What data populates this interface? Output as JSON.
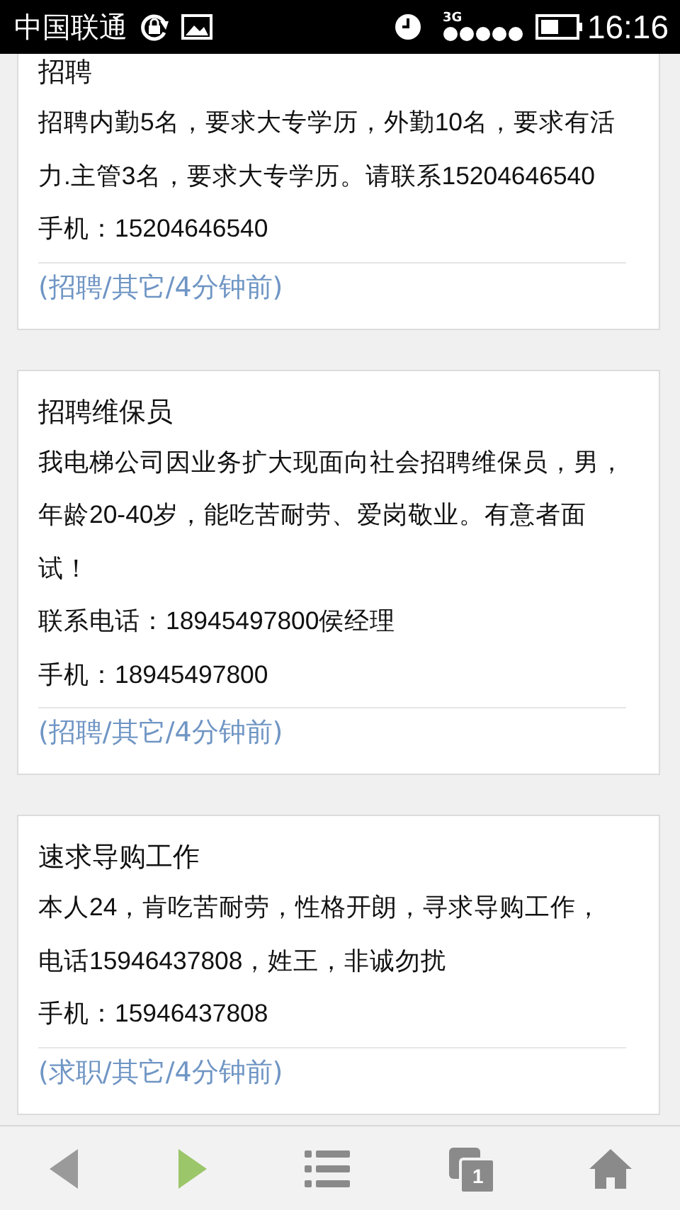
{
  "status_bar": {
    "carrier": "中国联通",
    "network": "3G",
    "time": "16:16"
  },
  "posts": [
    {
      "title": "招聘",
      "paragraphs": [
        "招聘内勤5名，要求大专学历，外勤10名，要求有活力.主管3名，要求大专学历。请联系15204646540"
      ],
      "phone": "手机：15204646540",
      "meta": "(招聘/其它/4分钟前)"
    },
    {
      "title": "招聘维保员",
      "paragraphs": [
        "我电梯公司因业务扩大现面向社会招聘维保员，男，年龄20-40岁，能吃苦耐劳、爱岗敬业。有意者面试！",
        "联系电话：18945497800侯经理"
      ],
      "phone": "手机：18945497800",
      "meta": "(招聘/其它/4分钟前)"
    },
    {
      "title": "速求导购工作",
      "paragraphs": [
        "本人24，肯吃苦耐劳，性格开朗，寻求导购工作，电话15946437808，姓王，非诚勿扰"
      ],
      "phone": "手机：15946437808",
      "meta": "(求职/其它/4分钟前)"
    }
  ],
  "toolbar": {
    "back_disabled": true,
    "forward_disabled": false,
    "tab_count": "1"
  }
}
